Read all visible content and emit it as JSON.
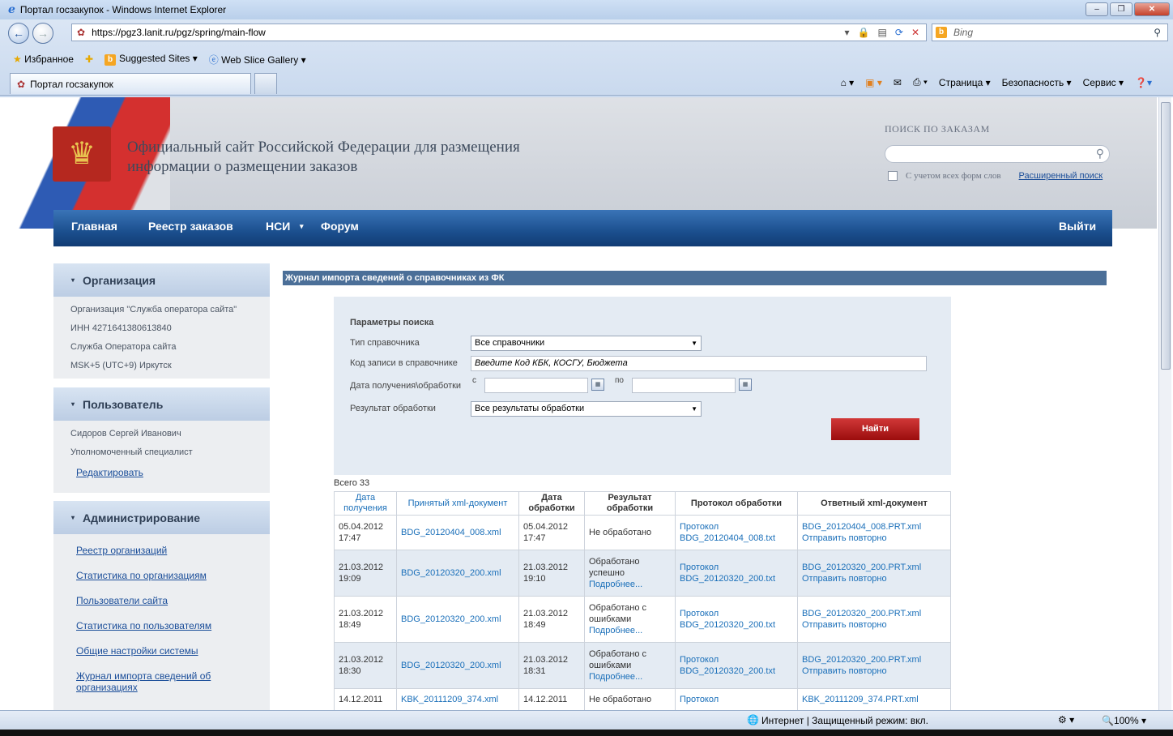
{
  "browser": {
    "title": "Портал госзакупок - Windows Internet Explorer",
    "url": "https://pgz3.lanit.ru/pgz/spring/main-flow",
    "search_engine": "Bing",
    "favorites_label": "Избранное",
    "fav_links": [
      "Suggested Sites",
      "Web Slice Gallery"
    ],
    "tab_title": "Портал госзакупок",
    "cmd_items": [
      "Страница",
      "Безопасность",
      "Сервис"
    ],
    "status_zone": "Интернет | Защищенный режим: вкл.",
    "zoom": "100%"
  },
  "site": {
    "title_line1": "Официальный сайт Российской Федерации для размещения",
    "title_line2": "информации о размещении заказов",
    "search_label": "ПОИСК ПО ЗАКАЗАМ",
    "search_all_forms": "С учетом всех форм слов",
    "advanced_search": "Расширенный поиск"
  },
  "nav": {
    "items": [
      "Главная",
      "Реестр заказов",
      "НСИ",
      "Форум"
    ],
    "logout": "Выйти"
  },
  "sidebar": {
    "org": {
      "title": "Организация",
      "lines": [
        "Организация \"Служба оператора сайта\"",
        "ИНН 4271641380613840",
        "Служба Оператора сайта",
        "MSK+5 (UTC+9) Иркутск"
      ]
    },
    "user": {
      "title": "Пользователь",
      "lines": [
        "Сидоров Сергей Иванович",
        "Уполномоченный специалист"
      ],
      "edit": "Редактировать"
    },
    "admin": {
      "title": "Администрирование",
      "links": [
        "Реестр организаций",
        "Статистика по организациям",
        "Пользователи сайта",
        "Статистика по пользователям",
        "Общие настройки системы",
        "Журнал импорта сведений об организациях"
      ]
    }
  },
  "content": {
    "title": "Журнал импорта сведений о справочниках из ФК",
    "params": {
      "heading": "Параметры поиска",
      "type_label": "Тип справочника",
      "type_value": "Все справочники",
      "code_label": "Код записи в справочнике",
      "code_placeholder": "Введите Код КБК, КОСГУ, Бюджета",
      "date_label": "Дата получения\\обработки",
      "from": "с",
      "to": "по",
      "result_label": "Результат обработки",
      "result_value": "Все результаты обработки",
      "find": "Найти"
    },
    "total": "Всего 33",
    "headers": [
      "Дата получения",
      "Принятый xml-документ",
      "Дата обработки",
      "Результат обработки",
      "Протокол обработки",
      "Ответный xml-документ"
    ],
    "rows": [
      {
        "recv_date": "05.04.2012",
        "recv_time": "17:47",
        "xml": "BDG_20120404_008.xml",
        "proc_date": "05.04.2012",
        "proc_time": "17:47",
        "result": "Не обработано",
        "details": "",
        "protocol1": "Протокол",
        "protocol2": "BDG_20120404_008.txt",
        "resp_xml": "BDG_20120404_008.PRT.xml",
        "resend": "Отправить повторно"
      },
      {
        "recv_date": "21.03.2012",
        "recv_time": "19:09",
        "xml": "BDG_20120320_200.xml",
        "proc_date": "21.03.2012",
        "proc_time": "19:10",
        "result": "Обработано успешно",
        "details": "Подробнее...",
        "protocol1": "Протокол",
        "protocol2": "BDG_20120320_200.txt",
        "resp_xml": "BDG_20120320_200.PRT.xml",
        "resend": "Отправить повторно"
      },
      {
        "recv_date": "21.03.2012",
        "recv_time": "18:49",
        "xml": "BDG_20120320_200.xml",
        "proc_date": "21.03.2012",
        "proc_time": "18:49",
        "result": "Обработано с ошибками",
        "details": "Подробнее...",
        "protocol1": "Протокол",
        "protocol2": "BDG_20120320_200.txt",
        "resp_xml": "BDG_20120320_200.PRT.xml",
        "resend": "Отправить повторно"
      },
      {
        "recv_date": "21.03.2012",
        "recv_time": "18:30",
        "xml": "BDG_20120320_200.xml",
        "proc_date": "21.03.2012",
        "proc_time": "18:31",
        "result": "Обработано с ошибками",
        "details": "Подробнее...",
        "protocol1": "Протокол",
        "protocol2": "BDG_20120320_200.txt",
        "resp_xml": "BDG_20120320_200.PRT.xml",
        "resend": "Отправить повторно"
      },
      {
        "recv_date": "14.12.2011",
        "recv_time": "",
        "xml": "KBK_20111209_374.xml",
        "proc_date": "14.12.2011",
        "proc_time": "",
        "result": "Не обработано",
        "details": "",
        "protocol1": "Протокол",
        "protocol2": "",
        "resp_xml": "KBK_20111209_374.PRT.xml",
        "resend": ""
      }
    ]
  }
}
